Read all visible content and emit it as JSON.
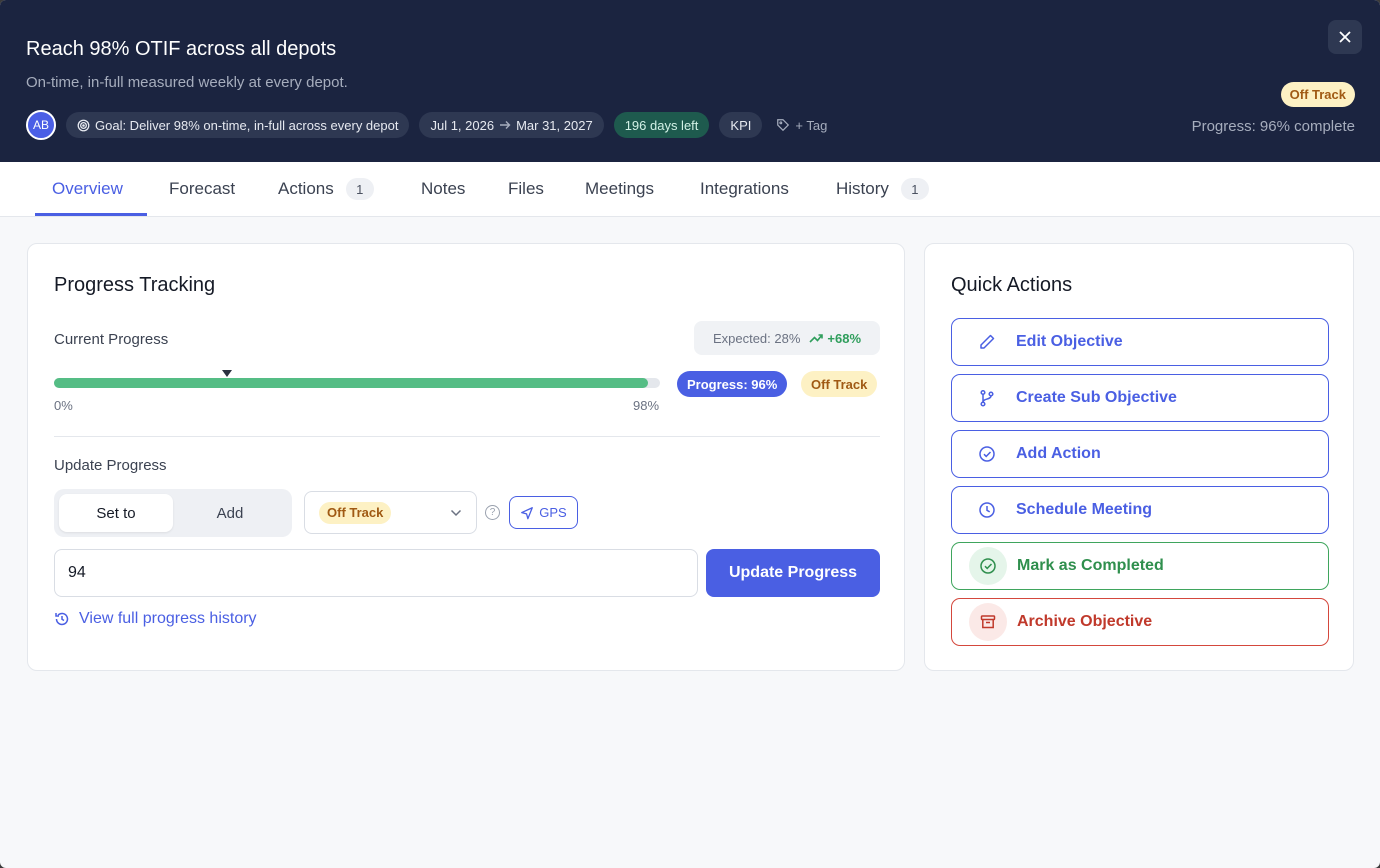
{
  "header": {
    "title": "Reach 98% OTIF across all depots",
    "subtitle": "On-time, in-full measured weekly at every depot.",
    "avatar": "AB",
    "goal_chip": "Goal: Deliver 98% on-time, in-full across every depot",
    "date_start": "Jul 1, 2026",
    "date_end": "Mar 31, 2027",
    "days_left": "196 days left",
    "kpi": "KPI",
    "tag": "+ Tag",
    "status": "Off Track",
    "progress_text": "Progress: 96% complete",
    "close_icon": "close-icon"
  },
  "tabs": [
    {
      "label": "Overview",
      "active": true
    },
    {
      "label": "Forecast"
    },
    {
      "label": "Actions",
      "badge": "1"
    },
    {
      "label": "Notes"
    },
    {
      "label": "Files"
    },
    {
      "label": "Meetings"
    },
    {
      "label": "Integrations"
    },
    {
      "label": "History",
      "badge": "1"
    }
  ],
  "progress": {
    "title": "Progress Tracking",
    "current_label": "Current Progress",
    "expected": "Expected: 28%",
    "delta": "+68%",
    "value": 96,
    "target": 98,
    "expected_value": 28,
    "axis_min": "0%",
    "axis_max": "98%",
    "progress_pill": "Progress: 96%",
    "status_pill": "Off Track",
    "update_label": "Update Progress",
    "mode_set": "Set to",
    "mode_add": "Add",
    "status_select": "Off Track",
    "gps": "GPS",
    "input_value": "94",
    "update_button": "Update Progress",
    "history_link": "View full progress history"
  },
  "quick_actions": {
    "title": "Quick Actions",
    "items": [
      {
        "label": "Edit Objective",
        "icon": "pencil-icon"
      },
      {
        "label": "Create Sub Objective",
        "icon": "branch-icon"
      },
      {
        "label": "Add Action",
        "icon": "check-circle-icon"
      },
      {
        "label": "Schedule Meeting",
        "icon": "clock-icon"
      },
      {
        "label": "Mark as Completed",
        "icon": "check-circle-icon"
      },
      {
        "label": "Archive Objective",
        "icon": "archive-icon"
      }
    ]
  },
  "colors": {
    "header_bg": "#1b2440",
    "accent": "#4a5fe3",
    "progress_fill": "#55bd85",
    "warning_bg": "#fdf1c4",
    "warning_text": "#a05a14",
    "success": "#3fa55d",
    "danger": "#d4473c"
  }
}
